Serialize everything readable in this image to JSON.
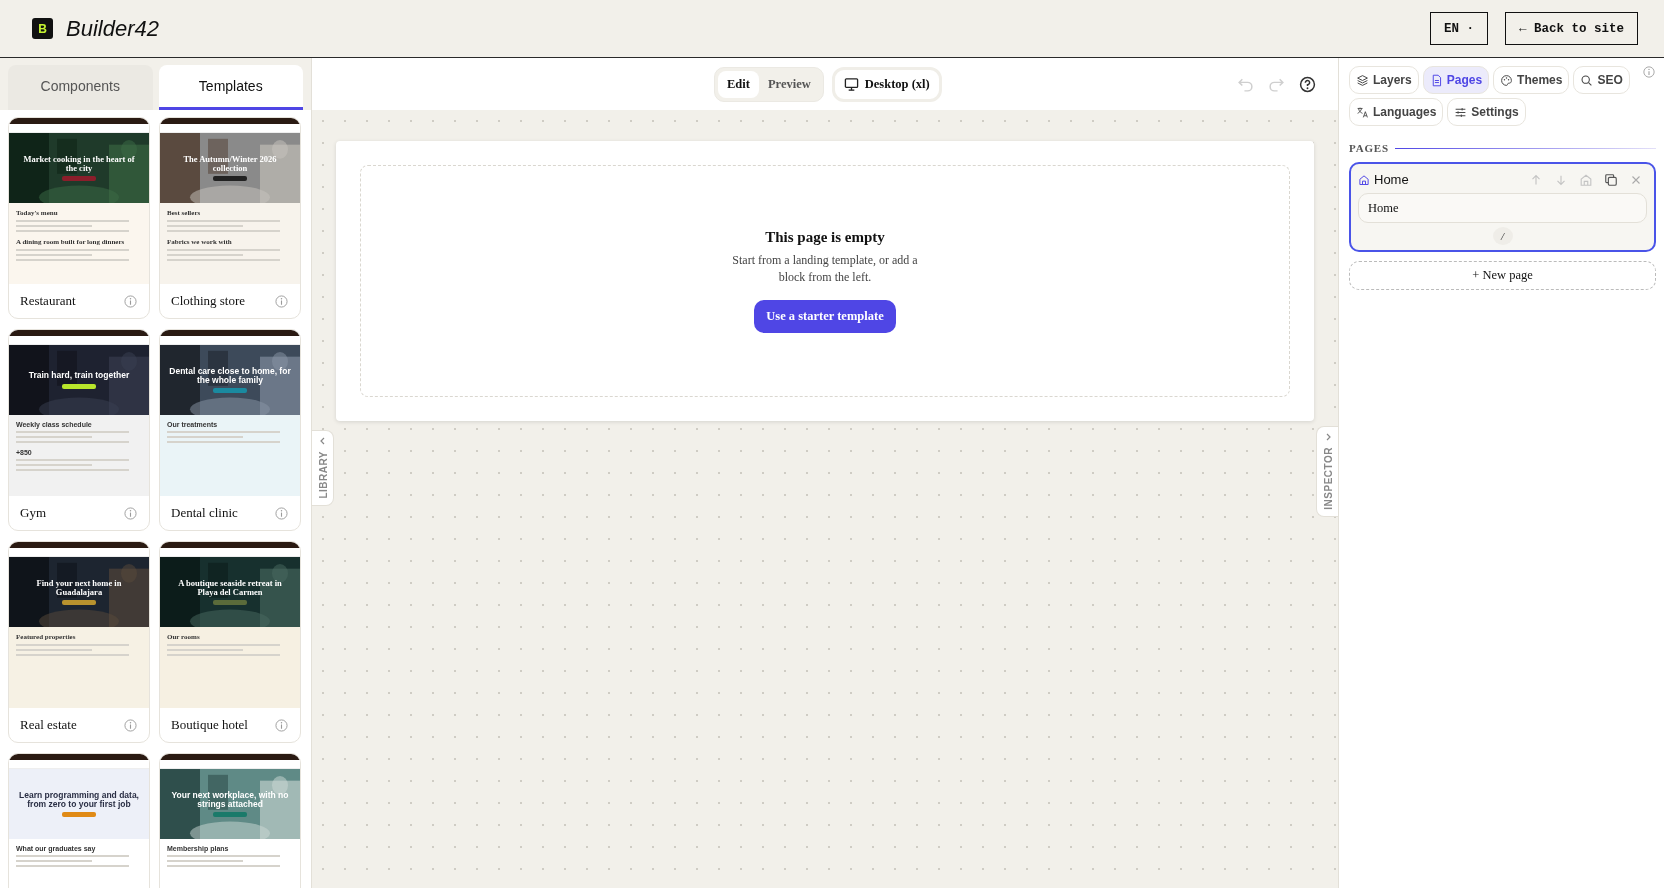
{
  "app": {
    "logo_letter": "B",
    "name": "Builder42"
  },
  "header_buttons": [
    "EN ·",
    "← Back to site"
  ],
  "library": {
    "tabs": [
      {
        "label": "Components",
        "selected": false
      },
      {
        "label": "Templates",
        "selected": true
      }
    ],
    "templates": [
      {
        "kind": "photo-hero",
        "name": "Restaurant",
        "hero": "Market cooking in the heart of the city",
        "sections": [
          "Today's menu",
          "A dining room built for long dinners"
        ]
      },
      {
        "kind": "photo-hero",
        "name": "Clothing store",
        "hero": "The Autumn/Winter 2026 collection",
        "sections": [
          "Best sellers",
          "Fabrics we work with"
        ]
      },
      {
        "kind": "photo-hero",
        "name": "Gym",
        "hero": "Train hard, train together",
        "sections": [
          "Weekly class schedule",
          "+850"
        ]
      },
      {
        "kind": "photo-hero",
        "name": "Dental clinic",
        "hero": "Dental care close to home, for the whole family",
        "sections": [
          "Our treatments"
        ]
      },
      {
        "kind": "photo-hero",
        "name": "Real estate",
        "hero": "Find your next home in Guadalajara",
        "sections": [
          "Featured properties"
        ]
      },
      {
        "kind": "photo-hero",
        "name": "Boutique hotel",
        "hero": "A boutique seaside retreat in Playa del Carmen",
        "sections": [
          "Our rooms"
        ]
      },
      {
        "kind": "plain-hero",
        "hero": "Learn programming and data, from zero to your first job",
        "sections": [
          "What our graduates say"
        ]
      },
      {
        "kind": "photo-hero",
        "hero": "Your next workplace, with no strings attached",
        "sections": [
          "Membership plans"
        ]
      }
    ]
  },
  "toolbar": {
    "modes": [
      {
        "label": "Edit",
        "selected": true
      },
      {
        "label": "Preview",
        "selected": false
      }
    ],
    "device": "Desktop (xl)",
    "undo": {
      "disabled": true
    },
    "redo": {
      "disabled": true
    }
  },
  "canvas": {
    "empty_title": "This page is empty",
    "empty_text": "Start from a landing template, or add a block from the left.",
    "cta": "Use a starter template",
    "left_tab": "LIBRARY",
    "right_tab": "INSPECTOR"
  },
  "inspector": {
    "tabs": [
      {
        "label": "Layers",
        "selected": false
      },
      {
        "label": "Pages",
        "selected": true
      },
      {
        "label": "Themes",
        "selected": false
      },
      {
        "label": "SEO",
        "selected": false
      },
      {
        "label": "Languages",
        "selected": false
      },
      {
        "label": "Settings",
        "selected": false
      }
    ],
    "section": "PAGES",
    "pages": [
      {
        "title": "Home",
        "name_value": "Home",
        "slug": "/",
        "selected": true
      }
    ],
    "new_page": "+ New page"
  }
}
